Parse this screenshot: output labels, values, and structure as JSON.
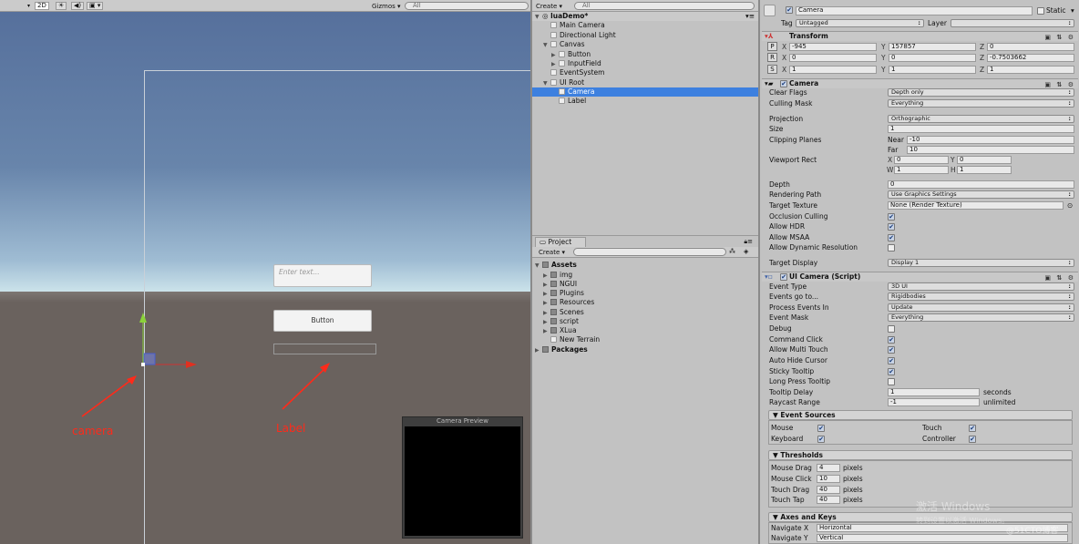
{
  "scene": {
    "toolbar": {
      "mode_2d": "2D",
      "gizmos": "Gizmos",
      "search_placeholder": "All"
    },
    "input_placeholder": "Enter text...",
    "button_label": "Button",
    "annotation_camera": "camera",
    "annotation_label": "Label",
    "camera_preview_title": "Camera Preview",
    "colors": {
      "annotation": "#ff2a1a",
      "sky": "#56709c",
      "ground": "#6a625e"
    }
  },
  "hierarchy": {
    "create": "Create",
    "search_placeholder": "All",
    "scene_name": "luaDemo*",
    "items": [
      {
        "label": "Main Camera"
      },
      {
        "label": "Directional Light"
      },
      {
        "label": "Canvas"
      },
      {
        "label": "Button"
      },
      {
        "label": "InputField"
      },
      {
        "label": "EventSystem"
      },
      {
        "label": "UI Root"
      },
      {
        "label": "Camera",
        "selected": true
      },
      {
        "label": "Label"
      }
    ]
  },
  "project": {
    "tab": "Project",
    "create": "Create",
    "root": "Assets",
    "folders": [
      "img",
      "NGUI",
      "Plugins",
      "Resources",
      "Scenes",
      "script",
      "XLua"
    ],
    "terrain": "New Terrain",
    "packages": "Packages"
  },
  "inspector": {
    "object_name": "Camera",
    "active": true,
    "static_label": "Static",
    "static": false,
    "tag_label": "Tag",
    "tag": "Untagged",
    "layer_label": "Layer",
    "layer": "",
    "transform": {
      "title": "Transform",
      "position": {
        "x": "-945",
        "y": "157857",
        "z": "0"
      },
      "rotation": {
        "x": "0",
        "y": "0",
        "z": "-0.7503662"
      },
      "scale": {
        "x": "1",
        "y": "1",
        "z": "1"
      }
    },
    "camera": {
      "title": "Camera",
      "enabled": true,
      "clear_flags": {
        "label": "Clear Flags",
        "value": "Depth only"
      },
      "culling_mask": {
        "label": "Culling Mask",
        "value": "Everything"
      },
      "projection": {
        "label": "Projection",
        "value": "Orthographic"
      },
      "size": {
        "label": "Size",
        "value": "1"
      },
      "clipping": {
        "label": "Clipping Planes",
        "near_label": "Near",
        "near": "-10",
        "far_label": "Far",
        "far": "10"
      },
      "viewport": {
        "label": "Viewport Rect",
        "x": "0",
        "y": "0",
        "w": "1",
        "h": "1"
      },
      "depth": {
        "label": "Depth",
        "value": "0"
      },
      "rendering_path": {
        "label": "Rendering Path",
        "value": "Use Graphics Settings"
      },
      "target_texture": {
        "label": "Target Texture",
        "value": "None (Render Texture)"
      },
      "occlusion": {
        "label": "Occlusion Culling",
        "checked": true
      },
      "hdr": {
        "label": "Allow HDR",
        "checked": true
      },
      "msaa": {
        "label": "Allow MSAA",
        "checked": true
      },
      "dynres": {
        "label": "Allow Dynamic Resolution",
        "checked": false
      },
      "target_display": {
        "label": "Target Display",
        "value": "Display 1"
      }
    },
    "ui_camera": {
      "title": "UI Camera (Script)",
      "enabled": true,
      "event_type": {
        "label": "Event Type",
        "value": "3D UI"
      },
      "events_go_to": {
        "label": "Events go to...",
        "value": "Rigidbodies"
      },
      "process_events": {
        "label": "Process Events In",
        "value": "Update"
      },
      "event_mask": {
        "label": "Event Mask",
        "value": "Everything"
      },
      "debug": {
        "label": "Debug",
        "checked": false
      },
      "command_click": {
        "label": "Command Click",
        "checked": true
      },
      "multi_touch": {
        "label": "Allow Multi Touch",
        "checked": true
      },
      "auto_hide": {
        "label": "Auto Hide Cursor",
        "checked": true
      },
      "sticky": {
        "label": "Sticky Tooltip",
        "checked": true
      },
      "long_press": {
        "label": "Long Press Tooltip",
        "checked": false
      },
      "tooltip_delay": {
        "label": "Tooltip Delay",
        "value": "1",
        "unit": "seconds"
      },
      "raycast": {
        "label": "Raycast Range",
        "value": "-1",
        "unit": "unlimited"
      },
      "event_sources": {
        "title": "Event Sources",
        "mouse": {
          "label": "Mouse",
          "checked": true
        },
        "keyboard": {
          "label": "Keyboard",
          "checked": true
        },
        "touch": {
          "label": "Touch",
          "checked": true
        },
        "controller": {
          "label": "Controller",
          "checked": true
        }
      },
      "thresholds": {
        "title": "Thresholds",
        "unit": "pixels",
        "mouse_drag": {
          "label": "Mouse Drag",
          "value": "4"
        },
        "mouse_click": {
          "label": "Mouse Click",
          "value": "10"
        },
        "touch_drag": {
          "label": "Touch Drag",
          "value": "40"
        },
        "touch_tap": {
          "label": "Touch Tap",
          "value": "40"
        }
      },
      "axes": {
        "title": "Axes and Keys",
        "nav_x": {
          "label": "Navigate X",
          "value": "Horizontal"
        },
        "nav_y": {
          "label": "Navigate Y",
          "value": "Vertical"
        }
      }
    }
  },
  "watermark": {
    "line1": "激活 Windows",
    "line2": "转到设置以激活 Windows。",
    "site": "@51CTO博客"
  }
}
